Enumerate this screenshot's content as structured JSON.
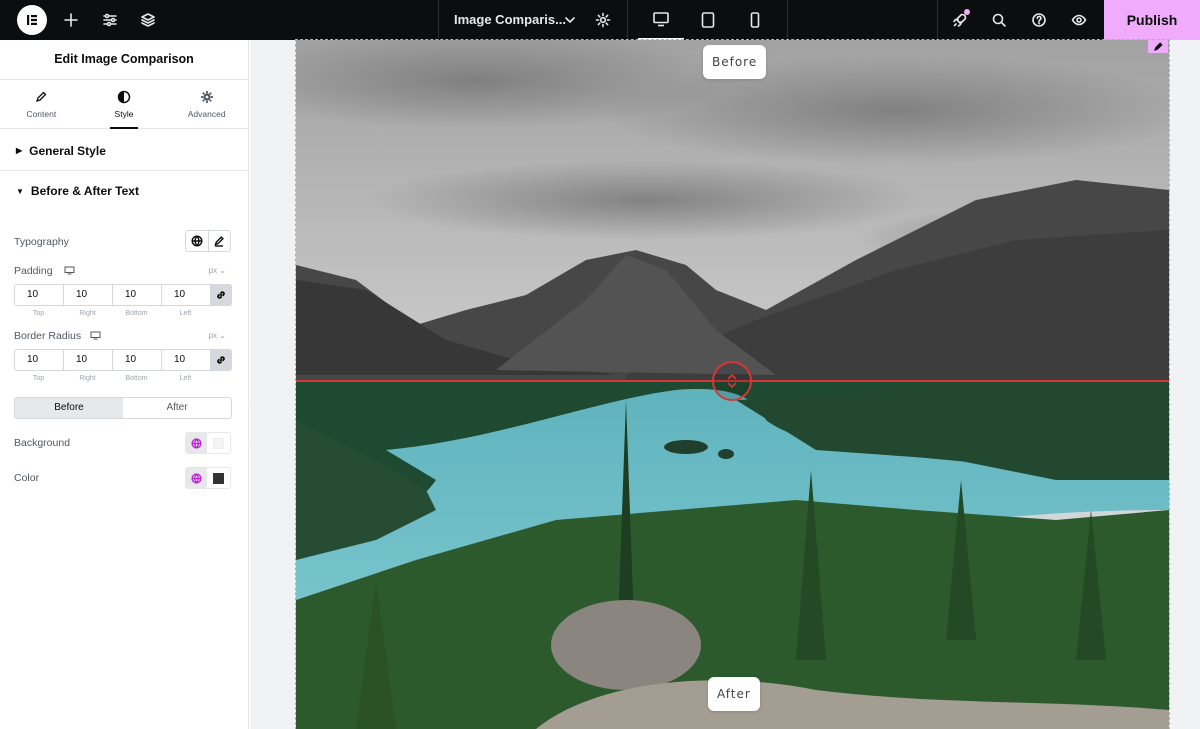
{
  "topbar": {
    "document_title": "Image Comparis...",
    "publish_label": "Publish",
    "publish_color": "#f0abfc"
  },
  "panel": {
    "title": "Edit Image Comparison",
    "tabs": [
      {
        "label": "Content",
        "icon": "pencil-icon"
      },
      {
        "label": "Style",
        "icon": "contrast-icon",
        "active": true
      },
      {
        "label": "Advanced",
        "icon": "gear-icon"
      }
    ],
    "general_style": "General Style",
    "before_after_text": "Before & After Text",
    "typography_label": "Typography",
    "padding": {
      "label": "Padding",
      "unit": "px",
      "values": [
        "10",
        "10",
        "10",
        "10"
      ],
      "sides": [
        "Top",
        "Right",
        "Bottom",
        "Left"
      ]
    },
    "border_radius": {
      "label": "Border Radius",
      "unit": "px",
      "values": [
        "10",
        "10",
        "10",
        "10"
      ],
      "sides": [
        "Top",
        "Right",
        "Bottom",
        "Left"
      ]
    },
    "state_toggle": {
      "before": "Before",
      "after": "After",
      "active": "Before"
    },
    "background_label": "Background",
    "color_label": "Color",
    "background_swatch": "#ffffff",
    "color_swatch": "#333333"
  },
  "canvas": {
    "before_label": "Before",
    "after_label": "After",
    "divider_position": 0.495,
    "accent_color": "#d63638"
  }
}
